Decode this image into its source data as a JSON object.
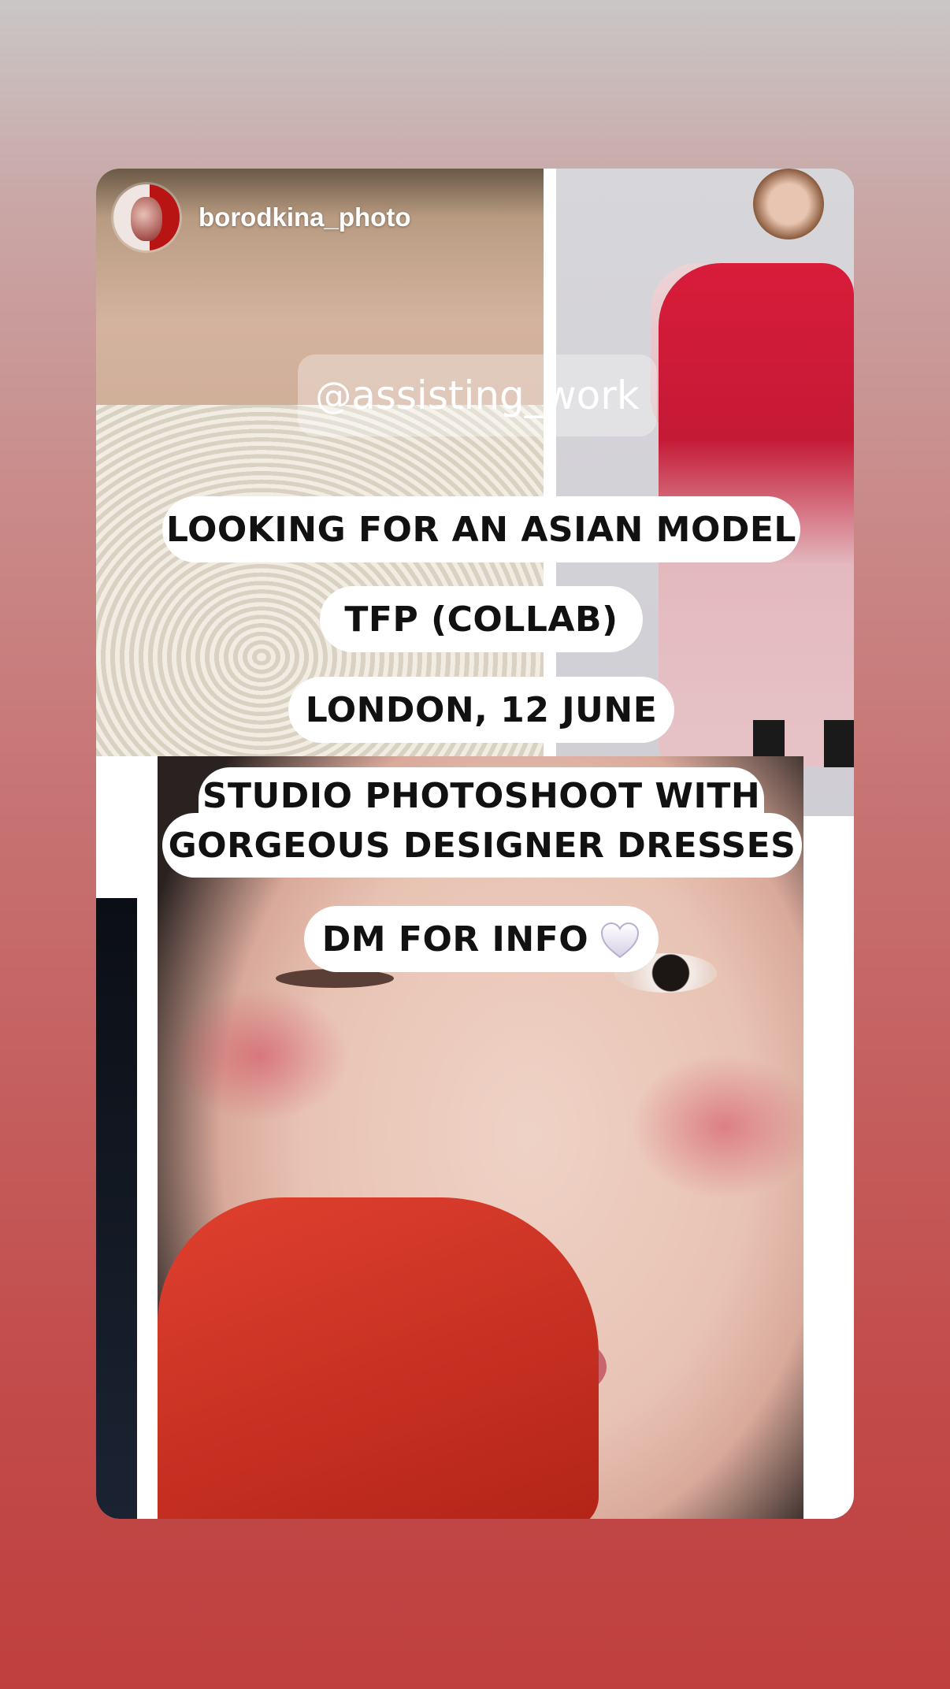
{
  "story": {
    "username": "borodkina_photo",
    "mention": "@assisting_work",
    "mention_icon": "threads-at-icon",
    "lines": [
      "LOOKING FOR AN ASIAN MODEL",
      "TFP (COLLAB)",
      "LONDON, 12 JUNE",
      "STUDIO PHOTOSHOOT WITH",
      "GORGEOUS DESIGNER DRESSES",
      "DM FOR INFO"
    ],
    "emoji": "white-heart-icon"
  },
  "colors": {
    "background_top": "#c9c7c6",
    "background_bottom": "#bf3f3e",
    "pill": "#ffffff",
    "pill_text": "#111111"
  }
}
